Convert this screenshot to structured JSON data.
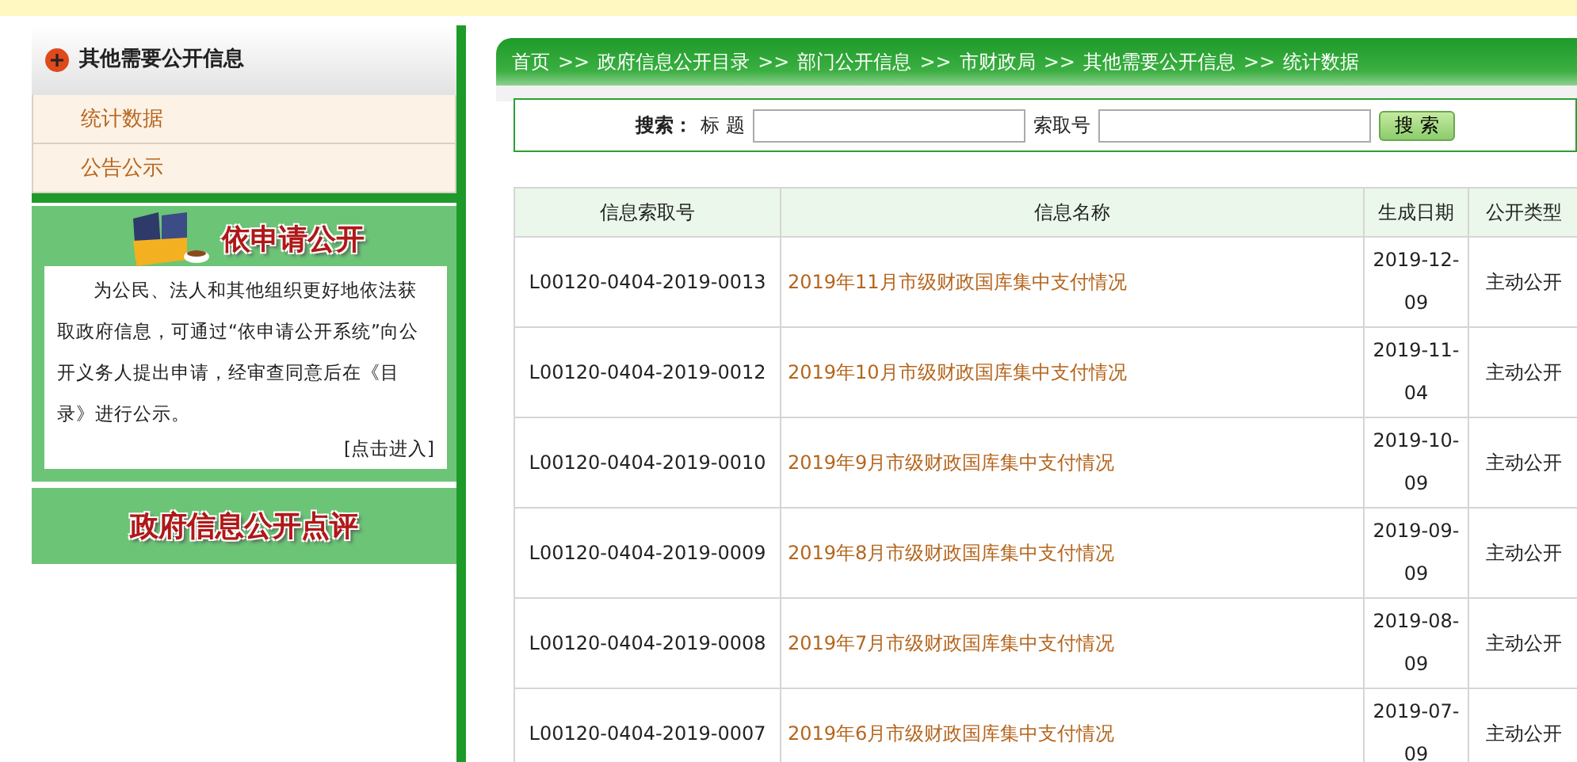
{
  "sidebar": {
    "title": "其他需要公开信息",
    "items": [
      {
        "label": "统计数据"
      },
      {
        "label": "公告公示"
      }
    ]
  },
  "apply_box": {
    "title": "依申请公开",
    "text": "为公民、法人和其他组织更好地依法获取政府信息，可通过“依申请公开系统”向公开义务人提出申请，经审查同意后在《目录》进行公示。",
    "link": "[点击进入]"
  },
  "review_banner": {
    "title": "政府信息公开点评"
  },
  "breadcrumb": [
    "首页",
    "政府信息公开目录",
    "部门公开信息",
    "市财政局",
    "其他需要公开信息",
    "统计数据"
  ],
  "breadcrumb_separator": ">>",
  "search": {
    "label": "搜索：",
    "title_label": "标 题",
    "index_label": "索取号",
    "button": "搜 索"
  },
  "table": {
    "columns": [
      "信息索取号",
      "信息名称",
      "生成日期",
      "公开类型"
    ],
    "rows": [
      {
        "index_no": "L00120-0404-2019-0013",
        "name": "2019年11月市级财政国库集中支付情况",
        "date": "2019-12-09",
        "type": "主动公开"
      },
      {
        "index_no": "L00120-0404-2019-0012",
        "name": "2019年10月市级财政国库集中支付情况",
        "date": "2019-11-04",
        "type": "主动公开"
      },
      {
        "index_no": "L00120-0404-2019-0010",
        "name": "2019年9月市级财政国库集中支付情况",
        "date": "2019-10-09",
        "type": "主动公开"
      },
      {
        "index_no": "L00120-0404-2019-0009",
        "name": "2019年8月市级财政国库集中支付情况",
        "date": "2019-09-09",
        "type": "主动公开"
      },
      {
        "index_no": "L00120-0404-2019-0008",
        "name": "2019年7月市级财政国库集中支付情况",
        "date": "2019-08-09",
        "type": "主动公开"
      },
      {
        "index_no": "L00120-0404-2019-0007",
        "name": "2019年6月市级财政国库集中支付情况",
        "date": "2019-07-09",
        "type": "主动公开"
      }
    ]
  }
}
